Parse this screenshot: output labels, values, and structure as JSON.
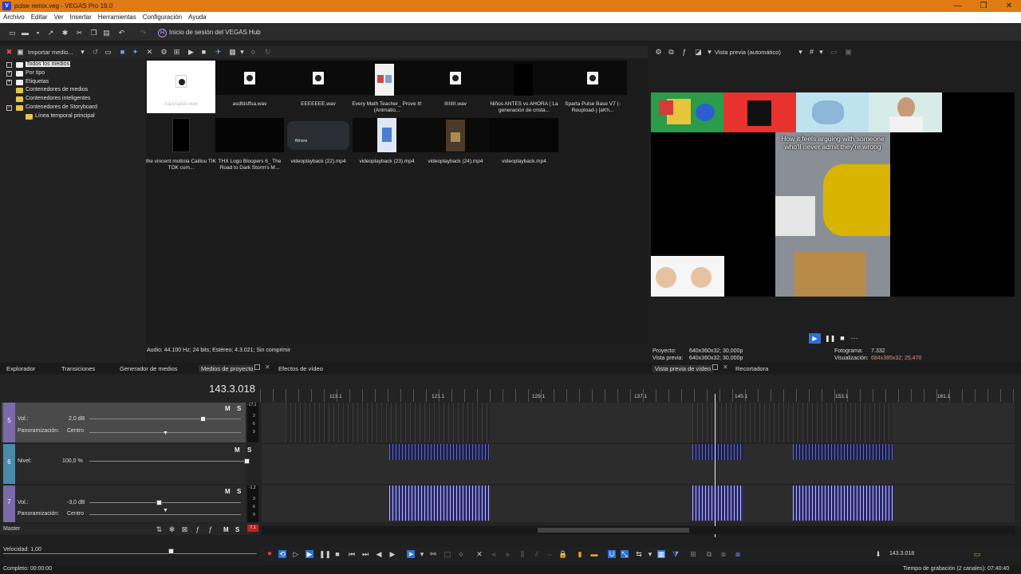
{
  "window": {
    "title": "pulse remix.veg - VEGAS Pro 19.0",
    "logo": "V",
    "minimize": "—",
    "maximize": "❐",
    "close": "✕"
  },
  "menu": [
    "Archivo",
    "Editar",
    "Ver",
    "Insertar",
    "Herramientas",
    "Configuración",
    "Ayuda"
  ],
  "toolbar": {
    "hub_label": "Inicio de sesión del VEGAS Hub",
    "hub_icon": "H"
  },
  "explorer": {
    "import_label": "Importar medio...",
    "tree": [
      {
        "label": "Todos los medios",
        "expander": "",
        "selected": true
      },
      {
        "label": "Por tipo",
        "expander": "+"
      },
      {
        "label": "Etiquetas",
        "expander": "+"
      },
      {
        "label": "Contenedores de medios",
        "expander": ""
      },
      {
        "label": "Contenedores inteligentes",
        "expander": ""
      },
      {
        "label": "Contenedores de Storyboard",
        "expander": "−"
      },
      {
        "label": "Línea temporal principal",
        "expander": "",
        "child": true
      }
    ],
    "media": [
      {
        "caption": "AaAAaAA.wav",
        "kind": "audio-selected"
      },
      {
        "caption": "asdfdsffsa.wav",
        "kind": "audio"
      },
      {
        "caption": "EEEEEEE.wav",
        "kind": "audio"
      },
      {
        "caption": "Every Math Teacher_ Prove It! (Animatio...",
        "kind": "video"
      },
      {
        "caption": "IIIIIIII.wav",
        "kind": "audio"
      },
      {
        "caption": "Niños ANTES vs AHORA ( La generación de crista...",
        "kind": "video"
      },
      {
        "caption": "Sparta Pulse Base V7 (-Reupload-) [aKh...",
        "kind": "audio"
      },
      {
        "caption": "the vincent mottola Caillou TIK TOK com...",
        "kind": "video"
      },
      {
        "caption": "THX Logo Bloopers 6_ The Road to Dark Storm's M...",
        "kind": "video"
      },
      {
        "caption": "videoplayback (22).mp4",
        "kind": "video"
      },
      {
        "caption": "videoplayback (23).mp4",
        "kind": "video"
      },
      {
        "caption": "videoplayback (24).mp4",
        "kind": "video"
      },
      {
        "caption": "videoplayback.mp4",
        "kind": "video"
      }
    ],
    "status": "Audio: 44.100 Hz; 24 bits; Estéreo; 4.3.021; Sin comprimir"
  },
  "preview": {
    "mode_label": "Vista previa (automático)",
    "overlay_text": "How it feels arguing with someone who'll never admit they're wrong",
    "filmora_label": "filmora",
    "proyecto_label": "Proyecto:",
    "proyecto_value": "640x360x32; 30,000p",
    "vista_label": "Vista previa:",
    "vista_value": "640x360x32; 30,000p",
    "fotograma_label": "Fotograma:",
    "fotograma_value": "7.332",
    "visualizacion_label": "Visualización:",
    "visualizacion_value": "684x385x32; 25,470",
    "more": "···"
  },
  "tabs": {
    "explorador": "Explorador",
    "transiciones": "Transiciones",
    "generador": "Generador de medios",
    "medios_proyecto": "Medios de proyecto",
    "efectos": "Efectos de vídeo",
    "vista_previa_video": "Vista previa de vídeo",
    "recortadora": "Recortadora"
  },
  "timeline": {
    "time": "143.3.018",
    "ruler": [
      "113.1",
      "121.1",
      "129.1",
      "137.1",
      "145.1",
      "153.1",
      "161.1"
    ],
    "tracks": [
      {
        "num": "5",
        "vol_label": "Vol.:",
        "vol_value": "2,0 dB",
        "pan_label": "Panoramización:",
        "pan_value": "Centro",
        "meter_top": "-17,1"
      },
      {
        "num": "6",
        "level_label": "Nivel:",
        "level_value": "100,0 %"
      },
      {
        "num": "7",
        "vol_label": "Vol.:",
        "vol_value": "-3,0 dB",
        "pan_label": "Panoramización:",
        "pan_value": "Centro",
        "meter_top": "-1,2"
      }
    ],
    "meter_ticks": [
      "3",
      "6",
      "9"
    ],
    "m_label": "M",
    "s_label": "S",
    "master_label": "Master",
    "master_peak": "7,1",
    "speed_label": "Velocidad: 1,00",
    "bottom_time": "143.3.018"
  },
  "status": {
    "left": "Completo: 00:00:00",
    "right": "Tiempo de grabación (2 canales): 07:40:40"
  }
}
